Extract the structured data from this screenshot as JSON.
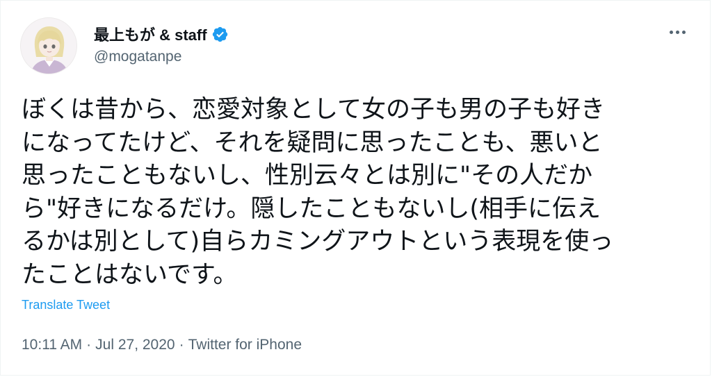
{
  "author": {
    "display_name": "最上もが & staff",
    "handle": "@mogatanpe",
    "verified_icon": "verified-badge-icon",
    "brand_color": "#1d9bf0"
  },
  "tweet": {
    "lines": [
      "ぼくは昔から、恋愛対象として女の子も男の子も好き",
      "になってたけど、それを疑問に思ったことも、悪いと",
      "思ったこともないし、性別云々とは別に\"その人だか",
      "ら\"好きになるだけ。隠したこともないし(相手に伝え",
      "るかは別として)自らカミングアウトという表現を使っ",
      "たことはないです。"
    ],
    "translate_label": "Translate Tweet",
    "time": "10:11 AM",
    "separator": "·",
    "date": "Jul 27, 2020",
    "source": "Twitter for iPhone"
  },
  "menu": {
    "icon": "more-horizontal-icon"
  }
}
